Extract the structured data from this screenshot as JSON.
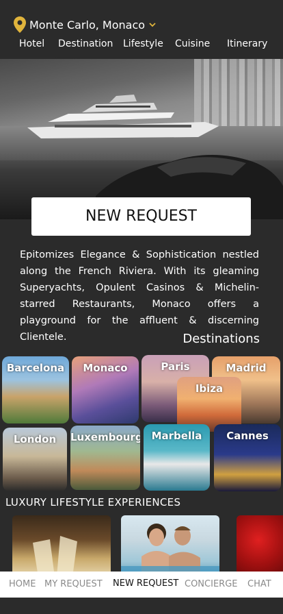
{
  "location": {
    "name": "Monte Carlo, Monaco"
  },
  "nav": [
    "Hotel",
    "Destination",
    "Lifestyle",
    "Cuisine",
    "Itinerary"
  ],
  "cta": {
    "label": "NEW REQUEST"
  },
  "description": "Epitomizes Elegance & Sophistication nestled along the French Riviera. With its gleaming Superyachts, Opulent Casinos & Michelin-starred Restaurants, Monaco offers a playground for the affluent & discerning Clientele.",
  "destinations_title": "Destinations",
  "destinations": [
    "Barcelona",
    "Monaco",
    "Paris",
    "Madrid",
    "Ibiza",
    "London",
    "Luxembourg",
    "Marbella",
    "Cannes"
  ],
  "experiences_title": "LUXURY LIFESTYLE EXPERIENCES",
  "bottom_nav": [
    "HOME",
    "MY REQUEST",
    "NEW REQUEST",
    "CONCIERGE",
    "CHAT"
  ],
  "bottom_nav_active": "NEW REQUEST",
  "colors": {
    "background": "#2b2b2b",
    "accent": "#e0b43c",
    "text": "#ffffff"
  }
}
